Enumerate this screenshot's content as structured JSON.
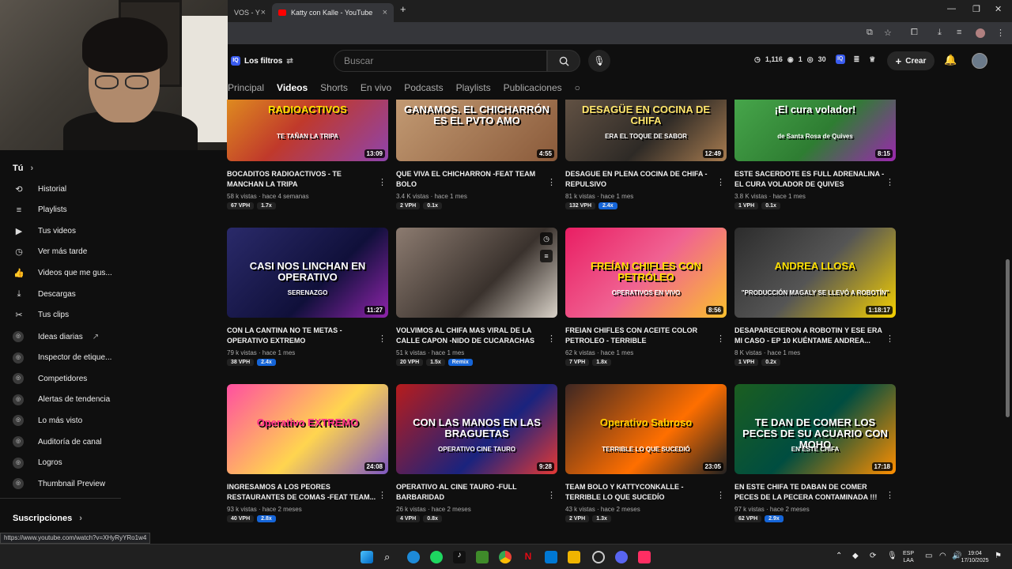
{
  "browser": {
    "tabs": [
      {
        "label": "VOS - Y"
      },
      {
        "label": "Katty con Kalle - YouTube"
      }
    ],
    "new_tab": "+",
    "status_url": "https://www.youtube.com/watch?v=XHyRyYRo1w4"
  },
  "masthead": {
    "filters_label": "Los filtros",
    "search_placeholder": "Buscar",
    "stats": {
      "views": "1,116",
      "comments": "1",
      "likes": "30"
    },
    "create_label": "Crear"
  },
  "channel_tabs": [
    {
      "label": "Principal"
    },
    {
      "label": "Videos"
    },
    {
      "label": "Shorts"
    },
    {
      "label": "En vivo"
    },
    {
      "label": "Podcasts"
    },
    {
      "label": "Playlists"
    },
    {
      "label": "Publicaciones"
    }
  ],
  "sidebar": {
    "you_heading": "Tú",
    "items": [
      {
        "label": "Historial",
        "icon": "history-icon",
        "glyph": "⟲"
      },
      {
        "label": "Playlists",
        "icon": "playlist-icon",
        "glyph": "≡"
      },
      {
        "label": "Tus videos",
        "icon": "your-videos-icon",
        "glyph": "▶"
      },
      {
        "label": "Ver más tarde",
        "icon": "clock-icon",
        "glyph": "◷"
      },
      {
        "label": "Videos que me gus...",
        "icon": "thumbs-up-icon",
        "glyph": "👍"
      },
      {
        "label": "Descargas",
        "icon": "download-icon",
        "glyph": "⤓"
      },
      {
        "label": "Tus clips",
        "icon": "scissors-icon",
        "glyph": "✂"
      }
    ],
    "extension_items": [
      {
        "label": "Ideas diarias"
      },
      {
        "label": "Inspector de etique..."
      },
      {
        "label": "Competidores"
      },
      {
        "label": "Alertas de tendencia"
      },
      {
        "label": "Lo más visto"
      },
      {
        "label": "Auditoría de canal"
      },
      {
        "label": "Logros"
      },
      {
        "label": "Thumbnail Preview"
      }
    ],
    "subscriptions_heading": "Suscripciones"
  },
  "videos": [
    {
      "thumb_text": "RADIOACTIVOS",
      "thumb_sub": "TE TAÑAN LA TRIPA",
      "duration": "13:09",
      "title": "BOCADITOS RADIOACTIVOS - TE MANCHAN LA TRIPA",
      "views": "58 k vistas",
      "age": "hace 4 semanas",
      "vph": "67 VPH",
      "ratio": "1.7x",
      "ratio_blue": false
    },
    {
      "thumb_text": "GANAMOS. EL CHICHARRÓN ES EL PVTO AMO",
      "thumb_sub": "",
      "duration": "4:55",
      "title": "QUE VIVA EL CHICHARRON -FEAT TEAM BOLO",
      "views": "3.4 K vistas",
      "age": "hace 1 mes",
      "vph": "2 VPH",
      "ratio": "0.1x",
      "ratio_blue": false
    },
    {
      "thumb_text": "DESAGÜE EN COCINA DE CHIFA",
      "thumb_sub": "ERA EL TOQUE DE SABOR",
      "duration": "12:49",
      "title": "DESAGUE EN PLENA COCINA DE CHIFA - REPULSIVO",
      "views": "81 k vistas",
      "age": "hace 1 mes",
      "vph": "132 VPH",
      "ratio": "2.4x",
      "ratio_blue": true
    },
    {
      "thumb_text": "¡El cura volador!",
      "thumb_sub": "de Santa Rosa de Quives",
      "duration": "8:15",
      "title": "ESTE SACERDOTE ES FULL ADRENALINA - EL CURA VOLADOR DE QUIVES",
      "views": "3.8 K vistas",
      "age": "hace 1 mes",
      "vph": "1 VPH",
      "ratio": "0.1x",
      "ratio_blue": false
    },
    {
      "thumb_text": "CASI NOS LINCHAN EN OPERATIVO",
      "thumb_sub": "SERENAZGO",
      "duration": "11:27",
      "title": "CON LA CANTINA NO TE METAS - OPERATIVO EXTREMO",
      "views": "79 k vistas",
      "age": "hace 1 mes",
      "vph": "38 VPH",
      "ratio": "2.4x",
      "ratio_blue": true
    },
    {
      "thumb_text": "",
      "thumb_sub": "",
      "duration": "",
      "title": "VOLVIMOS AL CHIFA MAS VIRAL DE LA CALLE CAPON -NIDO DE CUCARACHAS",
      "views": "51 k vistas",
      "age": "hace 1 mes",
      "vph": "20 VPH",
      "ratio": "1.5x",
      "ratio_blue": false,
      "extra_chip": "Remix"
    },
    {
      "thumb_text": "FREÍAN CHIFLES CON PETRÓLEO",
      "thumb_sub": "OPERATIVOS EN VIVO",
      "duration": "8:56",
      "title": "FREIAN CHIFLES CON ACEITE COLOR PETROLEO - TERRIBLE",
      "views": "62 k vistas",
      "age": "hace 1 mes",
      "vph": "7 VPH",
      "ratio": "1.8x",
      "ratio_blue": false
    },
    {
      "thumb_text": "ANDREA LLOSA",
      "thumb_sub": "\"PRODUCCIÓN MAGALY SE LLEVÓ A ROBOTÍN\"",
      "duration": "1:18:17",
      "title": "DESAPARECIERON A ROBOTIN Y ESE ERA MI CASO - EP 10 KUÉNTAME ANDREA...",
      "views": "8 K vistas",
      "age": "hace 1 mes",
      "vph": "1 VPH",
      "ratio": "0.2x",
      "ratio_blue": false
    },
    {
      "thumb_text": "Operativo EXTREMO",
      "thumb_sub": "",
      "duration": "24:08",
      "title": "INGRESAMOS A LOS PEORES RESTAURANTES DE COMAS -FEAT TEAM...",
      "views": "93 k vistas",
      "age": "hace 2 meses",
      "vph": "40 VPH",
      "ratio": "2.8x",
      "ratio_blue": true
    },
    {
      "thumb_text": "CON LAS MANOS EN LAS BRAGUETAS",
      "thumb_sub": "OPERATIVO CINE TAURO",
      "duration": "9:28",
      "title": "OPERATIVO AL CINE TAURO -FULL BARBARIDAD",
      "views": "26 k vistas",
      "age": "hace 2 meses",
      "vph": "4 VPH",
      "ratio": "0.8x",
      "ratio_blue": false
    },
    {
      "thumb_text": "Operativo Sabroso",
      "thumb_sub": "TERRIBLE LO QUE SUCEDIÓ",
      "duration": "23:05",
      "title": "TEAM BOLO Y KATTYCONKALLE - TERRIBLE LO QUE SUCEDÍO",
      "views": "43 k vistas",
      "age": "hace 2 meses",
      "vph": "2 VPH",
      "ratio": "1.3x",
      "ratio_blue": false
    },
    {
      "thumb_text": "TE DAN DE COMER LOS PECES DE SU ACUARIO CON MOHO",
      "thumb_sub": "EN ESTE CHIFA",
      "duration": "17:18",
      "title": "EN ESTE CHIFA TE DABAN DE COMER PECES DE LA PECERA CONTAMINADA !!!",
      "views": "97 k vistas",
      "age": "hace 2 meses",
      "vph": "62 VPH",
      "ratio": "2.9x",
      "ratio_blue": true
    }
  ],
  "taskbar": {
    "lang": "ESP",
    "lang2": "LAA",
    "time": "19:04",
    "date": "17/10/2025"
  }
}
